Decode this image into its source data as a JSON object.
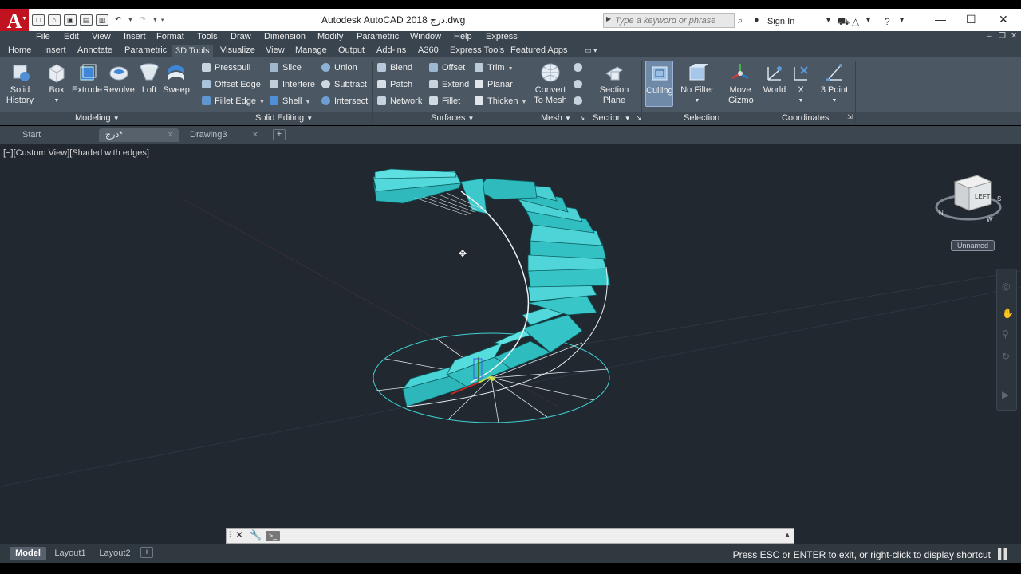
{
  "window": {
    "title": "Autodesk AutoCAD 2018   درج.dwg",
    "search_placeholder": "Type a keyword or phrase",
    "sign_in": "Sign In",
    "app_logo": "A"
  },
  "menu": [
    "File",
    "Edit",
    "View",
    "Insert",
    "Format",
    "Tools",
    "Draw",
    "Dimension",
    "Modify",
    "Parametric",
    "Window",
    "Help",
    "Express"
  ],
  "ribbon_tabs": [
    "Home",
    "Insert",
    "Annotate",
    "Parametric",
    "3D Tools",
    "Visualize",
    "View",
    "Manage",
    "Output",
    "Add-ins",
    "A360",
    "Express Tools",
    "Featured Apps"
  ],
  "ribbon_active_tab": "3D Tools",
  "ribbon": {
    "modeling": {
      "label": "Modeling",
      "solid_history": "Solid History",
      "box": "Box",
      "extrude": "Extrude",
      "revolve": "Revolve",
      "loft": "Loft",
      "sweep": "Sweep"
    },
    "solid_editing": {
      "label": "Solid Editing",
      "presspull": "Presspull",
      "slice": "Slice",
      "union": "Union",
      "offset_edge": "Offset Edge",
      "interfere": "Interfere",
      "subtract": "Subtract",
      "fillet_edge": "Fillet Edge",
      "shell": "Shell",
      "intersect": "Intersect"
    },
    "surfaces": {
      "label": "Surfaces",
      "blend": "Blend",
      "offset": "Offset",
      "trim": "Trim",
      "patch": "Patch",
      "extend": "Extend",
      "planar": "Planar",
      "network": "Network",
      "fillet": "Fillet",
      "thicken": "Thicken"
    },
    "mesh": {
      "label": "Mesh",
      "convert": "Convert To Mesh"
    },
    "section": {
      "label": "Section",
      "section_plane": "Section Plane"
    },
    "selection": {
      "label": "Selection",
      "culling": "Culling",
      "no_filter": "No Filter",
      "move_gizmo": "Move Gizmo"
    },
    "coordinates": {
      "label": "Coordinates",
      "world": "World",
      "x": "X",
      "three_point": "3 Point"
    }
  },
  "doc_tabs": {
    "start": "Start",
    "active": "درج*",
    "drawing3": "Drawing3"
  },
  "viewport": {
    "label": "[−][Custom View][Shaded with edges]",
    "viewcube_face": "LEFT",
    "ucs_name": "Unnamed",
    "viewcube_dir_n": "N",
    "viewcube_dir_w": "W",
    "viewcube_dir_s": "S"
  },
  "layout_tabs": [
    "Model",
    "Layout1",
    "Layout2"
  ],
  "status_text": "Press ESC or ENTER to exit, or right-click to display shortcut",
  "colors": {
    "stair": "#33c3c6",
    "stair_dark": "#1f9ea1",
    "viewport_bg": "#212830",
    "ribbon_bg": "#4b5763",
    "menubar_bg": "#39444f",
    "logo_red": "#c1121f"
  },
  "icons": [
    "new-icon",
    "open-icon",
    "save-icon",
    "saveas-icon",
    "plot-icon",
    "undo-icon",
    "redo-icon",
    "search-icon",
    "user-icon",
    "cart-icon",
    "help-icon"
  ]
}
